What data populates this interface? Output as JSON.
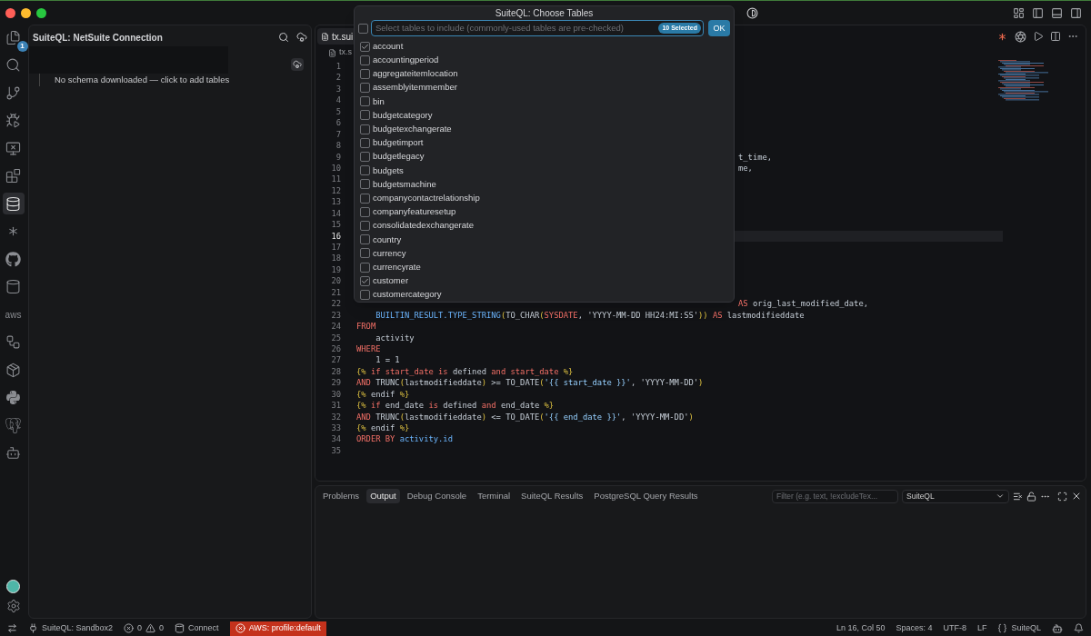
{
  "activity_bar": {
    "items": [
      {
        "kind": "files",
        "badge": "1",
        "selected": false
      },
      {
        "kind": "search",
        "selected": false
      },
      {
        "kind": "source-control",
        "selected": false
      },
      {
        "kind": "run-debug",
        "selected": false
      },
      {
        "kind": "remote",
        "selected": false
      },
      {
        "kind": "extensions",
        "selected": false
      },
      {
        "kind": "database",
        "selected": true
      },
      {
        "kind": "sparkle",
        "selected": false
      },
      {
        "kind": "github",
        "selected": false
      },
      {
        "kind": "cylinder",
        "selected": false
      },
      {
        "kind": "aws",
        "label": "aws",
        "selected": false
      },
      {
        "kind": "diagram",
        "selected": false
      },
      {
        "kind": "box",
        "selected": false
      },
      {
        "kind": "python",
        "selected": false
      },
      {
        "kind": "elephant",
        "selected": false
      },
      {
        "kind": "robot",
        "selected": false
      }
    ],
    "bottom": [
      {
        "kind": "avatar"
      },
      {
        "kind": "settings"
      }
    ]
  },
  "sidebar": {
    "title": "SuiteQL: NetSuite Connection",
    "tree_message": "No schema downloaded — click to add tables"
  },
  "editor": {
    "tab": "tx.sui",
    "breadcrumb": "tx.s",
    "lines": [
      {
        "number": "1",
        "current": false
      },
      {
        "number": "2",
        "current": false
      },
      {
        "number": "3",
        "current": false
      },
      {
        "number": "4",
        "current": false
      },
      {
        "number": "5",
        "current": false
      },
      {
        "number": "6",
        "current": false
      },
      {
        "number": "7",
        "current": false
      },
      {
        "number": "8",
        "current": false
      },
      {
        "number": "9",
        "current": false,
        "tail": [
          {
            "text": "t_time,",
            "kind": "plain"
          }
        ]
      },
      {
        "number": "10",
        "current": false,
        "tail": [
          {
            "text": "me,",
            "kind": "plain"
          }
        ]
      },
      {
        "number": "11",
        "current": false
      },
      {
        "number": "12",
        "current": false
      },
      {
        "number": "13",
        "current": false
      },
      {
        "number": "14",
        "current": false
      },
      {
        "number": "15",
        "current": false
      },
      {
        "number": "16",
        "current": true
      },
      {
        "number": "17",
        "current": false
      },
      {
        "number": "18",
        "current": false
      },
      {
        "number": "19",
        "current": false
      },
      {
        "number": "20",
        "current": false
      },
      {
        "number": "21",
        "current": false
      },
      {
        "number": "22",
        "current": false,
        "tail": [
          {
            "text": "AS",
            "kind": "keyword"
          },
          {
            "text": " orig_last_modified_date,",
            "kind": "plain"
          }
        ]
      },
      {
        "number": "23",
        "current": false,
        "code": [
          {
            "text": "    BUILTIN_RESULT.TYPE_STRING",
            "kind": "func"
          },
          {
            "text": "(",
            "kind": "punct"
          },
          {
            "text": "TO_CHAR",
            "kind": "plain"
          },
          {
            "text": "(",
            "kind": "punct"
          },
          {
            "text": "SYSDATE",
            "kind": "keyword"
          },
          {
            "text": ", 'YYYY-MM-DD HH24:MI:SS'",
            "kind": "plain"
          },
          {
            "text": "))",
            "kind": "punct"
          },
          {
            "text": " AS",
            "kind": "keyword"
          },
          {
            "text": " lastmodifieddate",
            "kind": "plain"
          }
        ]
      },
      {
        "number": "24",
        "current": false,
        "code": [
          {
            "text": "FROM",
            "kind": "keyword"
          }
        ]
      },
      {
        "number": "25",
        "current": false,
        "code": [
          {
            "text": "    activity",
            "kind": "plain"
          }
        ]
      },
      {
        "number": "26",
        "current": false,
        "code": [
          {
            "text": "WHERE",
            "kind": "keyword"
          }
        ]
      },
      {
        "number": "27",
        "current": false,
        "code": [
          {
            "text": "    1 = 1",
            "kind": "plain"
          }
        ]
      },
      {
        "number": "28",
        "current": false,
        "code": [
          {
            "text": "{%",
            "kind": "punct"
          },
          {
            "text": " if start_date is",
            "kind": "keyword"
          },
          {
            "text": " defined ",
            "kind": "plain"
          },
          {
            "text": "and start_date",
            "kind": "keyword"
          },
          {
            "text": " %}",
            "kind": "punct"
          }
        ]
      },
      {
        "number": "29",
        "current": false,
        "code": [
          {
            "text": "AND",
            "kind": "keyword"
          },
          {
            "text": " TRUNC",
            "kind": "plain"
          },
          {
            "text": "(",
            "kind": "punct"
          },
          {
            "text": "lastmodifieddate",
            "kind": "plain"
          },
          {
            "text": ")",
            "kind": "punct"
          },
          {
            "text": " >= TO_DATE",
            "kind": "plain"
          },
          {
            "text": "(",
            "kind": "punct"
          },
          {
            "text": "'{{ start_date }}'",
            "kind": "string"
          },
          {
            "text": ", 'YYYY-MM-DD'",
            "kind": "plain"
          },
          {
            "text": ")",
            "kind": "punct"
          }
        ]
      },
      {
        "number": "30",
        "current": false,
        "code": [
          {
            "text": "{%",
            "kind": "punct"
          },
          {
            "text": " endif ",
            "kind": "plain"
          },
          {
            "text": "%}",
            "kind": "punct"
          }
        ]
      },
      {
        "number": "31",
        "current": false,
        "code": [
          {
            "text": "{%",
            "kind": "punct"
          },
          {
            "text": " if",
            "kind": "keyword"
          },
          {
            "text": " end_date ",
            "kind": "plain"
          },
          {
            "text": "is",
            "kind": "keyword"
          },
          {
            "text": " defined ",
            "kind": "plain"
          },
          {
            "text": "and",
            "kind": "keyword"
          },
          {
            "text": " end_date ",
            "kind": "plain"
          },
          {
            "text": "%}",
            "kind": "punct"
          }
        ]
      },
      {
        "number": "32",
        "current": false,
        "code": [
          {
            "text": "AND",
            "kind": "keyword"
          },
          {
            "text": " TRUNC",
            "kind": "plain"
          },
          {
            "text": "(",
            "kind": "punct"
          },
          {
            "text": "lastmodifieddate",
            "kind": "plain"
          },
          {
            "text": ")",
            "kind": "punct"
          },
          {
            "text": " <= TO_DATE",
            "kind": "plain"
          },
          {
            "text": "(",
            "kind": "punct"
          },
          {
            "text": "'{{ end_date }}'",
            "kind": "string"
          },
          {
            "text": ", 'YYYY-MM-DD'",
            "kind": "plain"
          },
          {
            "text": ")",
            "kind": "punct"
          }
        ]
      },
      {
        "number": "33",
        "current": false,
        "code": [
          {
            "text": "{%",
            "kind": "punct"
          },
          {
            "text": " endif ",
            "kind": "plain"
          },
          {
            "text": "%}",
            "kind": "punct"
          }
        ]
      },
      {
        "number": "34",
        "current": false,
        "code": [
          {
            "text": "ORDER BY",
            "kind": "keyword"
          },
          {
            "text": " activity.id",
            "kind": "func"
          }
        ]
      },
      {
        "number": "35",
        "current": false
      }
    ]
  },
  "dialog": {
    "title": "SuiteQL: Choose Tables",
    "select_all_checked": false,
    "placeholder": "Select tables to include (commonly-used tables are pre-checked)",
    "selected_count": "10 Selected",
    "ok": "OK",
    "items": [
      {
        "label": "account",
        "checked": true
      },
      {
        "label": "accountingperiod",
        "checked": false
      },
      {
        "label": "aggregateitemlocation",
        "checked": false
      },
      {
        "label": "assemblyitemmember",
        "checked": false
      },
      {
        "label": "bin",
        "checked": false
      },
      {
        "label": "budgetcategory",
        "checked": false
      },
      {
        "label": "budgetexchangerate",
        "checked": false
      },
      {
        "label": "budgetimport",
        "checked": false
      },
      {
        "label": "budgetlegacy",
        "checked": false
      },
      {
        "label": "budgets",
        "checked": false
      },
      {
        "label": "budgetsmachine",
        "checked": false
      },
      {
        "label": "companycontactrelationship",
        "checked": false
      },
      {
        "label": "companyfeaturesetup",
        "checked": false
      },
      {
        "label": "consolidatedexchangerate",
        "checked": false
      },
      {
        "label": "country",
        "checked": false
      },
      {
        "label": "currency",
        "checked": false
      },
      {
        "label": "currencyrate",
        "checked": false
      },
      {
        "label": "customer",
        "checked": true
      },
      {
        "label": "customercategory",
        "checked": false
      }
    ]
  },
  "panel": {
    "tabs": [
      {
        "label": "Problems",
        "selected": false
      },
      {
        "label": "Output",
        "selected": true
      },
      {
        "label": "Debug Console",
        "selected": false
      },
      {
        "label": "Terminal",
        "selected": false
      },
      {
        "label": "SuiteQL Results",
        "selected": false
      },
      {
        "label": "PostgreSQL Query Results",
        "selected": false
      }
    ],
    "filter_placeholder": "Filter (e.g. text, !excludeTex...",
    "channel": "SuiteQL"
  },
  "status_bar": {
    "left": [
      {
        "kind": "remote"
      },
      {
        "kind": "connection",
        "text": "SuiteQL: Sandbox2"
      },
      {
        "kind": "problems",
        "errors": "0",
        "warnings": "0"
      },
      {
        "kind": "db",
        "text": "Connect"
      },
      {
        "kind": "error",
        "text": "AWS: profile:default"
      }
    ],
    "right": [
      {
        "kind": "text",
        "text": "Ln 16, Col 50"
      },
      {
        "kind": "text",
        "text": "Spaces: 4"
      },
      {
        "kind": "text",
        "text": "UTF-8"
      },
      {
        "kind": "text",
        "text": "LF"
      },
      {
        "kind": "language",
        "text": "SuiteQL"
      },
      {
        "kind": "copilot"
      },
      {
        "kind": "bell"
      }
    ]
  }
}
